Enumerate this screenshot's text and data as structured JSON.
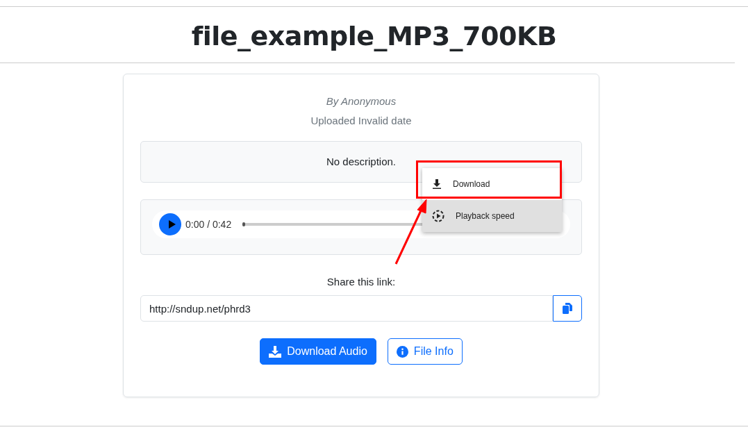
{
  "title": "file_example_MP3_700KB",
  "author": "By Anonymous",
  "uploaded": "Uploaded Invalid date",
  "description": "No description.",
  "player": {
    "time": "0:00 / 0:42",
    "level": 0
  },
  "menu": [
    {
      "label": "Download",
      "kind": "download",
      "selected": false
    },
    {
      "label": "Playback speed",
      "kind": "speed",
      "selected": true
    }
  ],
  "share": {
    "label": "Share this link:",
    "value": "http://sndup.net/phrd3"
  },
  "buttons": [
    {
      "label": "Download Audio",
      "kind": "primary"
    },
    {
      "label": "File Info",
      "kind": "outline"
    }
  ]
}
